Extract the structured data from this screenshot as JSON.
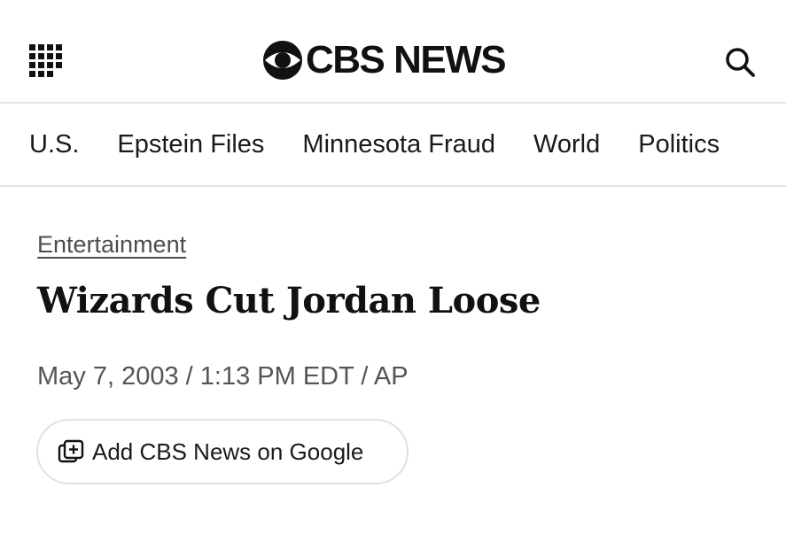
{
  "header": {
    "brand": "CBS NEWS",
    "icons": {
      "menu": "grid-menu-icon",
      "search": "search-icon",
      "logo": "cbs-eye-icon"
    }
  },
  "nav": {
    "items": [
      "U.S.",
      "Epstein Files",
      "Minnesota Fraud",
      "World",
      "Politics"
    ]
  },
  "article": {
    "category": "Entertainment",
    "headline": "Wizards Cut Jordan Loose",
    "byline": "May 7, 2003 / 1:13 PM EDT / AP",
    "google_button": {
      "label": "Add CBS News on Google",
      "icon": "add-source-icon"
    }
  },
  "colors": {
    "text": "#111111",
    "muted": "#555555",
    "divider": "#e4e4e4"
  }
}
